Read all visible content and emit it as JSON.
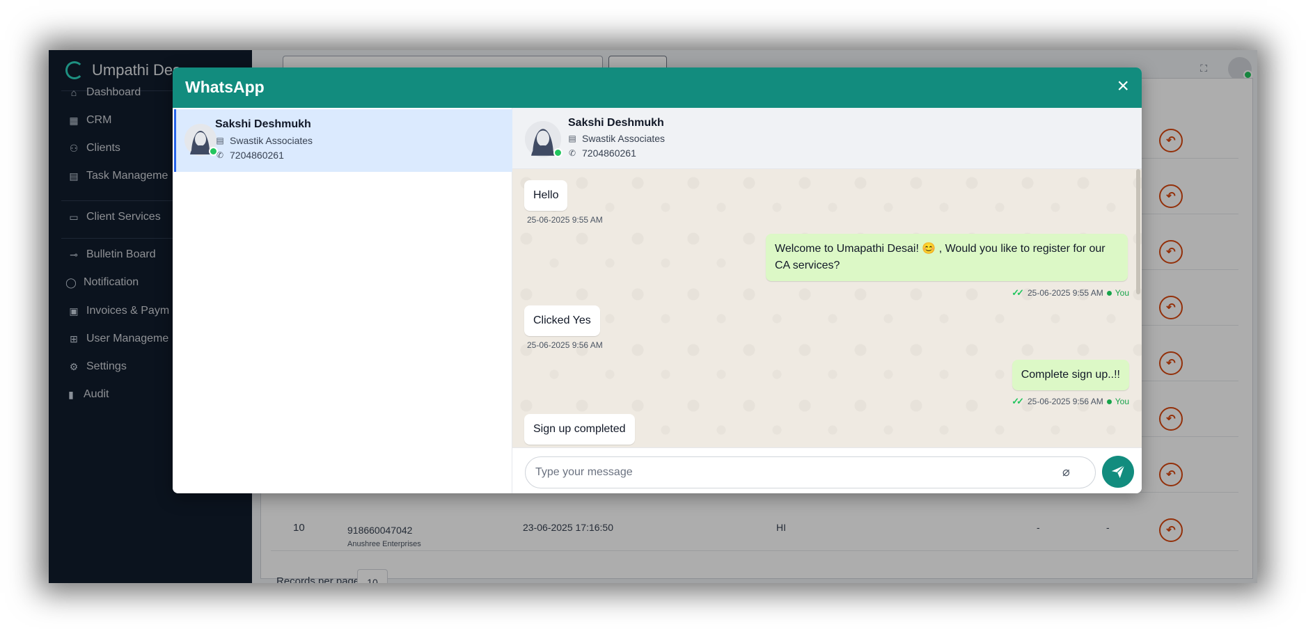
{
  "app": {
    "brand": "Umpathi Des",
    "sidebar": {
      "items": [
        {
          "label": "Dashboard",
          "icon": "home-icon"
        },
        {
          "label": "CRM",
          "icon": "table-icon"
        },
        {
          "label": "Clients",
          "icon": "users-icon"
        },
        {
          "label": "Task Manageme",
          "icon": "clipboard-icon"
        },
        {
          "label": "Client Services",
          "icon": "box-icon"
        },
        {
          "label": "Bulletin Board",
          "icon": "pin-icon"
        },
        {
          "label": "Notification",
          "icon": "whatsapp-icon"
        },
        {
          "label": "Invoices & Paym",
          "icon": "invoice-icon"
        },
        {
          "label": "User Manageme",
          "icon": "user-table-icon"
        },
        {
          "label": "Settings",
          "icon": "gear-icon"
        },
        {
          "label": "Audit",
          "icon": "file-icon"
        }
      ]
    },
    "table": {
      "row10": {
        "index": "10",
        "phone": "918660047042",
        "company": "Anushree Enterprises",
        "datetime": "23-06-2025 17:16:50",
        "message": "HI",
        "col5": "-",
        "col6": "-"
      },
      "records_per_page_label": "Records per page:",
      "records_per_page_value": "10"
    }
  },
  "modal": {
    "title": "WhatsApp",
    "close_label": "×",
    "contacts": [
      {
        "name": "Sakshi Deshmukh",
        "company": "Swastik Associates",
        "phone": "7204860261",
        "online": true
      }
    ],
    "chat": {
      "header": {
        "name": "Sakshi Deshmukh",
        "company": "Swastik Associates",
        "phone": "7204860261"
      },
      "messages": [
        {
          "direction": "in",
          "text": "Hello",
          "time": "25-06-2025 9:55 AM"
        },
        {
          "direction": "out",
          "text_line1": "Welcome to Umapathi Desai! 😊 , Would you like to register for our",
          "text_line2": "CA services?",
          "time": "25-06-2025 9:55 AM",
          "sender": "You"
        },
        {
          "direction": "in",
          "text": "Clicked Yes",
          "time": "25-06-2025 9:56 AM"
        },
        {
          "direction": "out",
          "text": "Complete sign up..!!",
          "time": "25-06-2025 9:56 AM",
          "sender": "You"
        },
        {
          "direction": "in",
          "text": "Sign up completed"
        }
      ],
      "composer": {
        "placeholder": "Type your message"
      }
    }
  },
  "colors": {
    "whatsapp_green": "#128c7e",
    "outgoing_bubble": "#dcf8c6",
    "sidebar_bg": "#111c2d",
    "reply_accent": "#d9480f"
  }
}
